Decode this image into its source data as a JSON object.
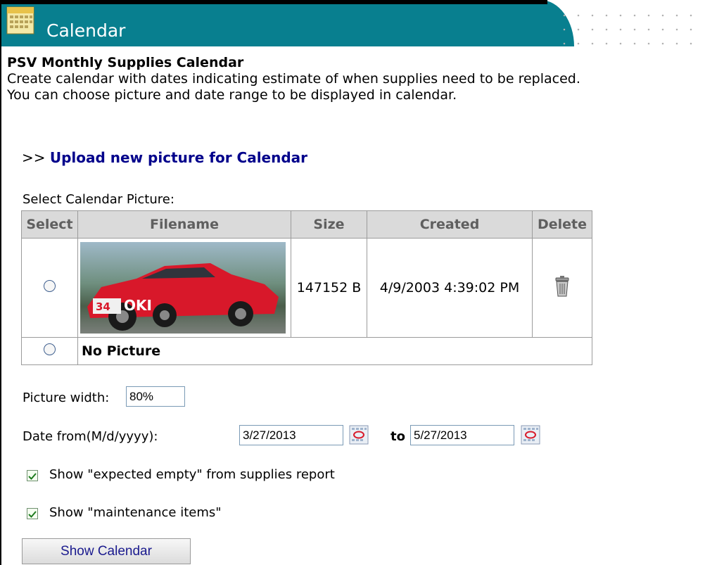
{
  "header": {
    "title": "Calendar",
    "accent_color": "#087f8f"
  },
  "intro": {
    "title": "PSV Monthly Supplies Calendar",
    "line1": "Create calendar with dates indicating estimate of when supplies need to be replaced.",
    "line2": "You can choose picture and date range to be displayed in calendar."
  },
  "upload": {
    "prefix": ">>",
    "link_label": "Upload new picture for Calendar"
  },
  "picture_table": {
    "caption": "Select Calendar Picture:",
    "columns": [
      "Select",
      "Filename",
      "Size",
      "Created",
      "Delete"
    ],
    "rows": [
      {
        "size": "147152 B",
        "created": "4/9/2003 4:39:02 PM",
        "thumbnail_icon": "red-race-car-image",
        "thumbnail_text": "OKI",
        "thumbnail_number": "34"
      },
      {
        "label": "No Picture"
      }
    ]
  },
  "form": {
    "picture_width_label": "Picture width:",
    "picture_width_value": "80%",
    "date_from_label": "Date from(M/d/yyyy):",
    "date_from_value": "3/27/2013",
    "to_label": "to",
    "date_to_value": "5/27/2013",
    "show_expected_empty_label": "Show \"expected empty\" from supplies report",
    "show_maintenance_label": "Show \"maintenance items\"",
    "show_calendar_button": "Show Calendar"
  }
}
